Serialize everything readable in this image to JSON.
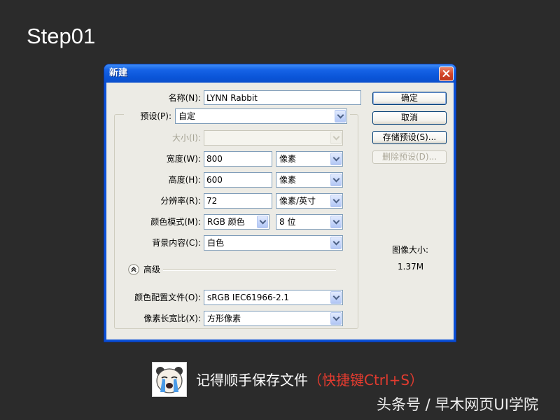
{
  "step_title": "Step01",
  "dialog": {
    "title": "新建",
    "name": {
      "label": "名称(N):",
      "value": "LYNN Rabbit"
    },
    "buttons": {
      "ok": "确定",
      "cancel": "取消",
      "save_preset": "存储预设(S)...",
      "delete_preset": "删除预设(D)...",
      "delete_preset_disabled": true
    },
    "preset": {
      "label": "预设(P):",
      "value": "自定"
    },
    "size": {
      "label": "大小(I):",
      "disabled": true
    },
    "width": {
      "label": "宽度(W):",
      "value": "800",
      "unit": "像素"
    },
    "height": {
      "label": "高度(H):",
      "value": "600",
      "unit": "像素"
    },
    "resolution": {
      "label": "分辨率(R):",
      "value": "72",
      "unit": "像素/英寸"
    },
    "color_mode": {
      "label": "颜色模式(M):",
      "mode": "RGB 颜色",
      "depth": "8 位"
    },
    "background": {
      "label": "背景内容(C):",
      "value": "白色"
    },
    "advanced": {
      "label": "高级"
    },
    "color_profile": {
      "label": "颜色配置文件(O):",
      "value": "sRGB IEC61966-2.1"
    },
    "pixel_aspect": {
      "label": "像素长宽比(X):",
      "value": "方形像素"
    },
    "image_size": {
      "label": "图像大小:",
      "value": "1.37M"
    }
  },
  "caption": {
    "text": "记得顺手保存文件",
    "shortcut": "（快捷键Ctrl+S）"
  },
  "watermark": "头条号 / 早木网页UI学院",
  "colors": {
    "background": "#2b2b2b",
    "title_bar": "#0a55d8",
    "close_button": "#d5462a",
    "dialog_body": "#ecebe5",
    "shortcut_text": "#e23b2f",
    "caption_text": "#ffffff"
  },
  "icons": {
    "close": "close-icon",
    "dropdown": "dropdown-arrow-icon",
    "advanced_toggle": "collapse-chevron-icon",
    "sticker": "crying-face-sticker"
  }
}
